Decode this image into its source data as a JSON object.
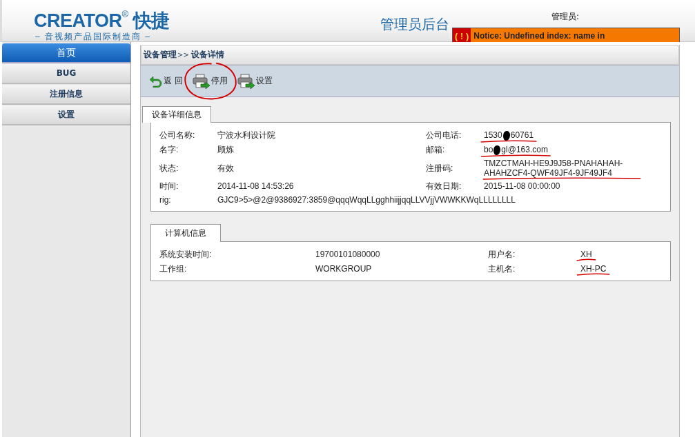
{
  "header": {
    "logo_text": "CREATOR",
    "logo_mark": "®",
    "logo_cn": "快捷",
    "tagline": "– 音视频产品国际制造商 –",
    "title": "管理员后台",
    "admin_label": "管理员:",
    "notice": {
      "icon_text": "( ! )",
      "text": "Notice: Undefined index: name in"
    }
  },
  "sidebar": {
    "items": [
      {
        "label": "首页",
        "selected": true
      },
      {
        "label": "BUG",
        "selected": false
      },
      {
        "label": "注册信息",
        "selected": false
      },
      {
        "label": "设置",
        "selected": false
      }
    ]
  },
  "breadcrumb": {
    "parent": "设备管理",
    "separator": ">>",
    "current": "设备详情"
  },
  "toolbar": [
    {
      "kind": "back",
      "label": "返 回",
      "circled": false
    },
    {
      "kind": "printer",
      "label": "停用",
      "circled": true
    },
    {
      "kind": "printer",
      "label": "设置",
      "circled": false
    }
  ],
  "device_panel": {
    "tab": "设备详细信息",
    "rows": [
      [
        {
          "label": "公司名称:",
          "segments": [
            "宁波水利设计院"
          ],
          "underlined": false
        },
        {
          "label": "公司电话:",
          "segments": [
            "1530",
            "60761"
          ],
          "underlined": true
        }
      ],
      [
        {
          "label": "名字:",
          "segments": [
            "顾炼"
          ],
          "underlined": false
        },
        {
          "label": "邮箱:",
          "segments": [
            "bo",
            "gl@163.com"
          ],
          "underlined": true
        }
      ],
      [
        {
          "label": "状态:",
          "segments": [
            "有效"
          ],
          "underlined": false
        },
        {
          "label": "注册码:",
          "segments": [
            "TMZCTMAH-HE9J9J58-PNAHAHAH-AHAHZCF4-QWF49JF4-9JF49JF4"
          ],
          "underlined": true
        }
      ],
      [
        {
          "label": "时间:",
          "segments": [
            "2014-11-08 14:53:26"
          ],
          "underlined": false
        },
        {
          "label": "有效日期:",
          "segments": [
            "2015-11-08 00:00:00"
          ],
          "underlined": false
        }
      ],
      [
        {
          "label": "rig:",
          "segments": [
            "GJC9>5>@2@9386927:3859@qqqWqqLLgghhiijjqqLLVVjjVWWKKWqLLLLLLLL"
          ],
          "underlined": false
        }
      ]
    ]
  },
  "computer_panel": {
    "tab": "计算机信息",
    "rows": [
      [
        {
          "label": "系统安装时间:",
          "segments": [
            "19700101080000"
          ],
          "underlined": false
        },
        {
          "label": "用户名:",
          "segments": [
            "XH"
          ],
          "underlined": true
        }
      ],
      [
        {
          "label": "工作组:",
          "segments": [
            "WORKGROUP"
          ],
          "underlined": false
        },
        {
          "label": "主机名:",
          "segments": [
            "XH-PC"
          ],
          "underlined": true
        }
      ]
    ]
  }
}
